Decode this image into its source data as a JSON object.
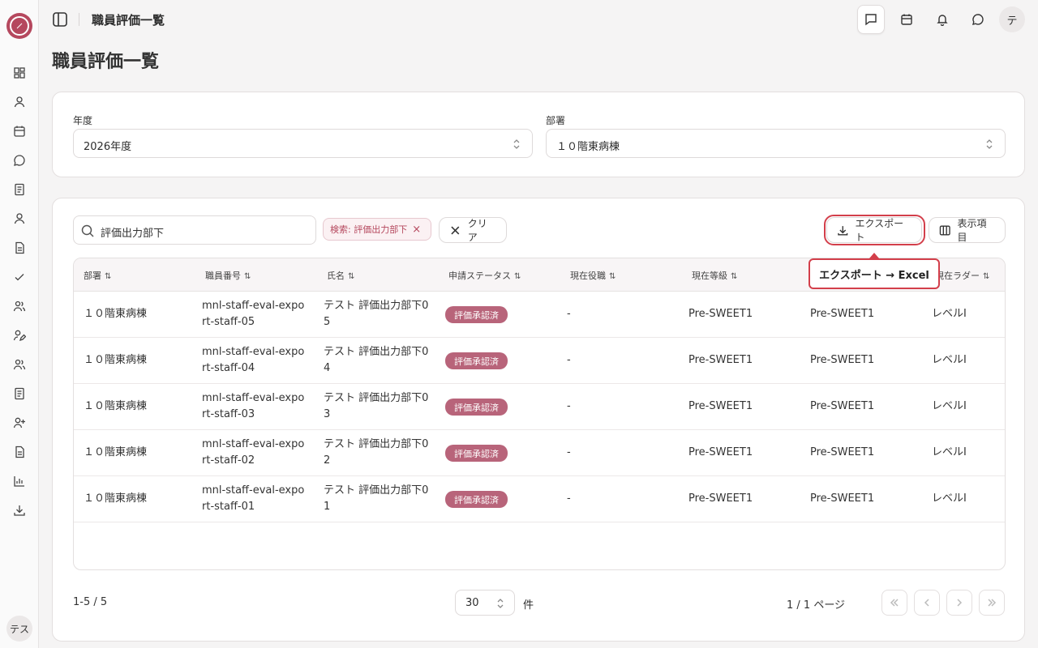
{
  "sidebar": {
    "nav_icons": [
      "dashboard-icon",
      "user-icon",
      "calendar-icon",
      "chat-icon",
      "document-icon",
      "user-icon",
      "file-icon",
      "check-icon",
      "users-icon",
      "user-edit-icon",
      "users-icon",
      "document-icon",
      "user-plus-icon",
      "file-icon",
      "chart-icon",
      "download-icon"
    ],
    "user_label": "テス"
  },
  "header": {
    "title": "職員評価一覧",
    "avatar_label": "テ"
  },
  "page": {
    "title": "職員評価一覧"
  },
  "filters": {
    "year_label": "年度",
    "year_value": "2026年度",
    "dept_label": "部署",
    "dept_value": "１０階東病棟"
  },
  "toolbar": {
    "search_value": "評価出力部下",
    "chip_label": "検索: 評価出力部下",
    "clear_label": "クリア",
    "export_label": "エクスポート",
    "columns_label": "表示項目",
    "tooltip": "エクスポート → Excel"
  },
  "table": {
    "columns": [
      "部署",
      "職員番号",
      "氏名",
      "申請ステータス",
      "現在役職",
      "現在等級",
      "",
      "現在ラダー"
    ],
    "rows": [
      {
        "dept": "１０階東病棟",
        "id": "mnl-staff-eval-expo\nrt-staff-05",
        "name": "テスト 評価出力部下0\n5",
        "status": "評価承認済",
        "role": "-",
        "grade": "Pre-SWEET1",
        "grade2": "Pre-SWEET1",
        "ladder": "レベルI"
      },
      {
        "dept": "１０階東病棟",
        "id": "mnl-staff-eval-expo\nrt-staff-04",
        "name": "テスト 評価出力部下0\n4",
        "status": "評価承認済",
        "role": "-",
        "grade": "Pre-SWEET1",
        "grade2": "Pre-SWEET1",
        "ladder": "レベルI"
      },
      {
        "dept": "１０階東病棟",
        "id": "mnl-staff-eval-expo\nrt-staff-03",
        "name": "テスト 評価出力部下0\n3",
        "status": "評価承認済",
        "role": "-",
        "grade": "Pre-SWEET1",
        "grade2": "Pre-SWEET1",
        "ladder": "レベルI"
      },
      {
        "dept": "１０階東病棟",
        "id": "mnl-staff-eval-expo\nrt-staff-02",
        "name": "テスト 評価出力部下0\n2",
        "status": "評価承認済",
        "role": "-",
        "grade": "Pre-SWEET1",
        "grade2": "Pre-SWEET1",
        "ladder": "レベルI"
      },
      {
        "dept": "１０階東病棟",
        "id": "mnl-staff-eval-expo\nrt-staff-01",
        "name": "テスト 評価出力部下0\n1",
        "status": "評価承認済",
        "role": "-",
        "grade": "Pre-SWEET1",
        "grade2": "Pre-SWEET1",
        "ladder": "レベルI"
      }
    ]
  },
  "pagination": {
    "count": "1-5 / 5",
    "page_size": "30",
    "unit": "件",
    "page_info": "1 / 1 ページ"
  },
  "colors": {
    "accent": "#b5485e",
    "badge": "#b8647a",
    "highlight": "#d33f4b"
  }
}
